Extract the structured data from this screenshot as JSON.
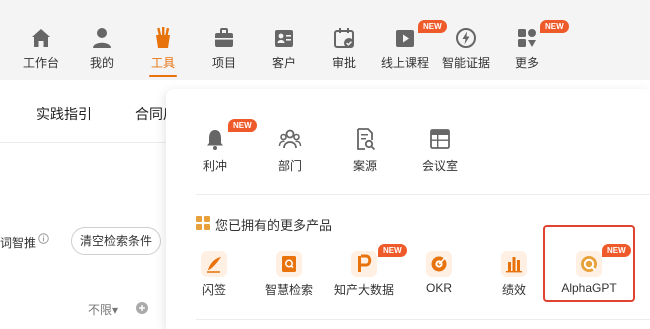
{
  "nav": {
    "items": [
      {
        "label": "工作台",
        "icon": "home-icon"
      },
      {
        "label": "我的",
        "icon": "user-icon"
      },
      {
        "label": "工具",
        "icon": "tools-icon",
        "active": true
      },
      {
        "label": "项目",
        "icon": "briefcase-icon"
      },
      {
        "label": "客户",
        "icon": "contact-card-icon"
      },
      {
        "label": "审批",
        "icon": "calendar-check-icon"
      },
      {
        "label": "线上课程",
        "icon": "video-play-icon",
        "badge": "NEW"
      },
      {
        "label": "智能证据",
        "icon": "lightning-circle-icon"
      },
      {
        "label": "更多",
        "icon": "grid-more-icon",
        "badge": "NEW"
      }
    ]
  },
  "page": {
    "tabs": [
      "实践指引",
      "合同后"
    ],
    "filter_label": "词智推",
    "clear_button": "清空检索条件",
    "unlimited": "不限▾"
  },
  "panel": {
    "tools": [
      {
        "label": "利冲",
        "icon": "bell-icon",
        "badge": "NEW"
      },
      {
        "label": "部门",
        "icon": "team-icon"
      },
      {
        "label": "案源",
        "icon": "document-search-icon"
      },
      {
        "label": "会议室",
        "icon": "table-grid-icon"
      }
    ],
    "section_title": "您已拥有的更多产品",
    "products": [
      {
        "label": "闪签",
        "icon": "quill-icon"
      },
      {
        "label": "智慧检索",
        "icon": "search-book-icon"
      },
      {
        "label": "知产大数据",
        "icon": "ip-logo-icon",
        "badge": "NEW"
      },
      {
        "label": "OKR",
        "icon": "okr-target-icon"
      },
      {
        "label": "绩效",
        "icon": "bar-chart-icon"
      },
      {
        "label": "AlphaGPT",
        "icon": "alphagpt-icon",
        "badge": "NEW"
      }
    ],
    "colors": {
      "accent": "#e8730d",
      "badge": "#ef5a2a",
      "highlight": "#e0432f"
    }
  }
}
